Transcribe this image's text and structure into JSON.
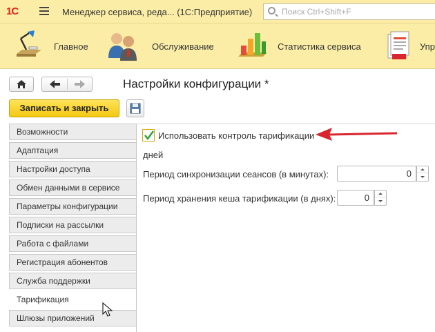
{
  "titlebar": {
    "logo": "1С",
    "app_title": "Менеджер сервиса, реда...  (1С:Предприятие)",
    "search_placeholder": "Поиск Ctrl+Shift+F"
  },
  "sections": [
    {
      "label": "Главное",
      "icon": "desk-lamp-icon"
    },
    {
      "label": "Обслуживание",
      "icon": "users-icon"
    },
    {
      "label": "Статистика сервиса",
      "icon": "bar-chart-icon"
    },
    {
      "label": "Упр",
      "icon": "documents-icon"
    }
  ],
  "form": {
    "title": "Настройки конфигурации *",
    "save_close_label": "Записать и закрыть"
  },
  "menu": [
    {
      "label": "Возможности",
      "active": false
    },
    {
      "label": "Адаптация",
      "active": false
    },
    {
      "label": "Настройки доступа",
      "active": false
    },
    {
      "label": "Обмен данными в сервисе",
      "active": false
    },
    {
      "label": "Параметры конфигурации",
      "active": false
    },
    {
      "label": "Подписки на рассылки",
      "active": false
    },
    {
      "label": "Работа с файлами",
      "active": false
    },
    {
      "label": "Регистрация абонентов",
      "active": false
    },
    {
      "label": "Служба поддержки",
      "active": false
    },
    {
      "label": "Тарификация",
      "active": true
    },
    {
      "label": "Шлюзы приложений",
      "active": false
    }
  ],
  "content": {
    "checkbox_label": "Использовать контроль тарификации",
    "checkbox_checked": true,
    "days_label": "дней",
    "sync_label": "Период синхронизации сеансов (в минутах):",
    "sync_value": "0",
    "cache_label": "Период хранения кеша тарификации (в днях):",
    "cache_value": "0"
  },
  "colors": {
    "accent_yellow": "#fbeda6",
    "button_yellow": "#f2c811",
    "logo_red": "#e2231a",
    "annotation_red": "#d9262e",
    "check_green": "#2e9e3a"
  }
}
